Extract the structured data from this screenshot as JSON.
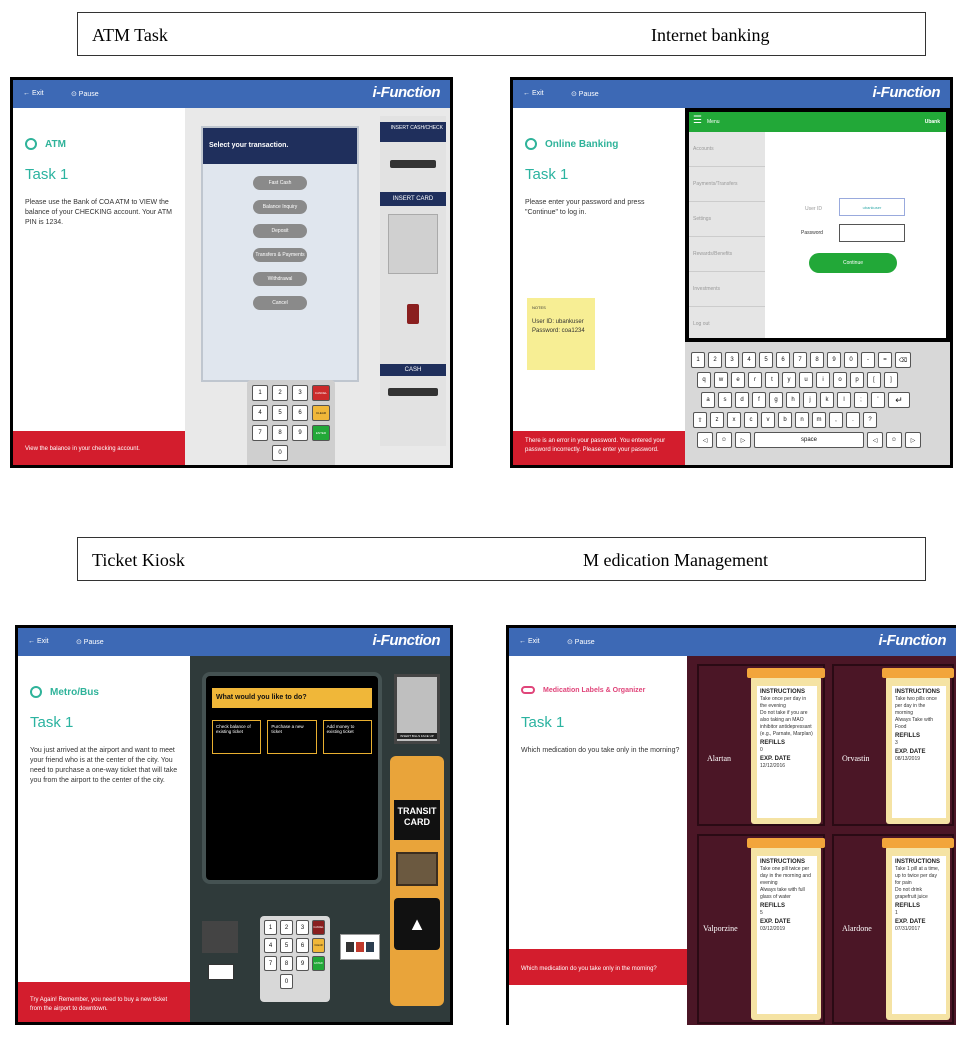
{
  "captions": {
    "atm": "ATM Task",
    "banking": "Internet banking",
    "kiosk": "Ticket Kiosk",
    "medication": "M edication Management"
  },
  "common": {
    "exit": "← Exit",
    "pause": "⊙ Pause",
    "brand": "i-Function",
    "task": "Task 1"
  },
  "atm": {
    "title": "ATM",
    "instruction": "Please use the Bank of COA ATM to VIEW the balance of your CHECKING account. Your ATM PIN is 1234.",
    "prompt": "Select your transaction.",
    "options": [
      "Fast Cash",
      "Balance Inquiry",
      "Deposit",
      "Transfers & Payments",
      "Withdrawal",
      "Cancel"
    ],
    "insert_check": "INSERT CASH/CHECK",
    "insert_card": "INSERT CARD",
    "cash": "CASH",
    "keypad": [
      "1",
      "2",
      "3",
      "4",
      "5",
      "6",
      "7",
      "8",
      "9",
      "0"
    ],
    "side_keys": [
      "CANCEL",
      "CLEAR",
      "ENTER"
    ],
    "footer": "View the balance in your checking account."
  },
  "banking": {
    "title": "Online Banking",
    "instruction": "Please enter your password and press \"Continue\" to log in.",
    "menu": "Menu",
    "bank": "Ubank",
    "nav": [
      "Accounts",
      "Payments/Transfers",
      "Settings",
      "Rewards/Benefits",
      "Investments",
      "Log out"
    ],
    "user_label": "User ID",
    "user_value": "ubankuser",
    "password_label": "Password",
    "continue": "Continue",
    "note_title": "NOTES",
    "note_line1": "User ID: ubankuser",
    "note_line2": "Password: coa1234",
    "footer": "There is an error in your password. You entered your password incorrectly. Please enter your password.",
    "kb_row1": [
      "1",
      "2",
      "3",
      "4",
      "5",
      "6",
      "7",
      "8",
      "9",
      "0",
      "-",
      "="
    ],
    "kb_row2": [
      "q",
      "w",
      "e",
      "r",
      "t",
      "y",
      "u",
      "i",
      "o",
      "p",
      "[",
      "]"
    ],
    "kb_row3": [
      "a",
      "s",
      "d",
      "f",
      "g",
      "h",
      "j",
      "k",
      "l",
      ";",
      "'"
    ],
    "kb_row4": [
      "z",
      "x",
      "c",
      "v",
      "b",
      "n",
      "m",
      ",",
      ".",
      "?"
    ],
    "space": "space"
  },
  "kiosk": {
    "title": "Metro/Bus",
    "instruction": "You just arrived at the airport and want to meet your friend who is at the center of the city. You need to purchase a one-way ticket that will take you from the airport to the center of the city.",
    "prompt": "What would you like to do?",
    "options": [
      "Check balance of existing ticket",
      "Purchase a new ticket",
      "Add money to existing ticket"
    ],
    "insert_bills": "INSERT BILLS FACE UP",
    "transit_card": "TRANSIT CARD",
    "keypad": [
      "1",
      "2",
      "3",
      "4",
      "5",
      "6",
      "7",
      "8",
      "9",
      "0"
    ],
    "side_keys": [
      "CANCEL",
      "CLEAR",
      "ENTER"
    ],
    "footer": "Try Again! Remember, you need to buy a new ticket from the airport to downtown."
  },
  "medication": {
    "title": "Medication Labels & Organizer",
    "question": "Which medication do you take only in the morning?",
    "footer": "Which medication do you take only in the morning?",
    "meds": [
      {
        "name": "Alartan",
        "lines": [
          "Take once per day in the evening",
          "Do not take if you are also taking an MAO inhibitor antidepressant (e.g., Parnate, Marplan)"
        ],
        "refills": "0",
        "exp": "12/12/2016"
      },
      {
        "name": "Orvastin",
        "lines": [
          "Take two pills once per day in the morning",
          "Always Take with Food"
        ],
        "refills": "3",
        "exp": "08/13/2019"
      },
      {
        "name": "Valporzine",
        "lines": [
          "Take one pill twice per day in the morning and evening",
          "Always take with full glass of water"
        ],
        "refills": "5",
        "exp": "03/12/2019"
      },
      {
        "name": "Alardone",
        "lines": [
          "Take 1 pill at a time, up to twice per day for pain",
          "Do not drink grapefruit juice"
        ],
        "refills": "1",
        "exp": "07/31/2017"
      }
    ],
    "instructions_label": "INSTRUCTIONS",
    "refills_label": "REFILLS",
    "exp_label": "EXP. DATE"
  },
  "colors": {
    "topbar": "#3d69b5",
    "teal": "#2fb39a",
    "red": "#d31d2d",
    "navy": "#1f2f5c",
    "green": "#22a838",
    "yellow": "#f0b739",
    "maroon": "#4b1626"
  }
}
